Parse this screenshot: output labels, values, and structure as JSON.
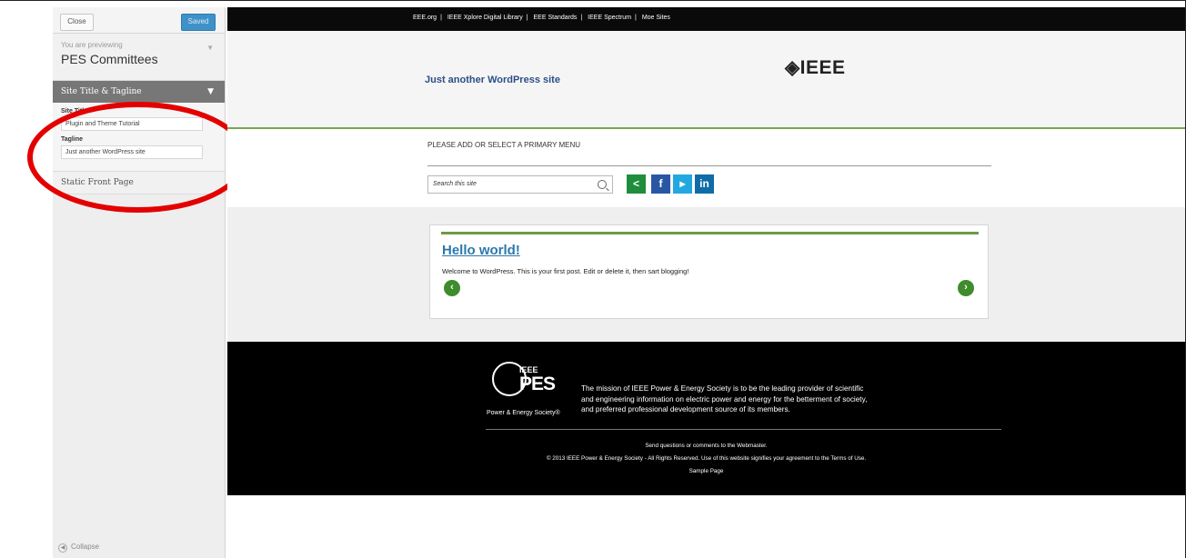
{
  "customizer": {
    "close_label": "Close",
    "saved_label": "Saved",
    "preview_note": "You are previewing",
    "preview_title": "PES Committees",
    "section_title": "Site Title & Tagline",
    "site_title_label": "Site Title",
    "site_title_value": "Plugin and Theme Tutorial",
    "tagline_label": "Tagline",
    "tagline_value": "Just another WordPress site",
    "static_front_page": "Static Front Page",
    "collapse_label": "Collapse"
  },
  "topbar": {
    "links": [
      "EEE.org",
      "IEEE Xplore Digital Library",
      "EEE Standards",
      "IEEE Spectrum",
      "Moe Sites"
    ]
  },
  "site": {
    "tagline": "Just another WordPress site",
    "logo": "IEEE",
    "menu_note": "PLEASE ADD OR SELECT A PRIMARY MENU",
    "search_placeholder": "Search this site"
  },
  "post": {
    "title": "Hello world!",
    "excerpt": "Welcome to WordPress. This is your first post. Edit or delete it, then sart blogging!"
  },
  "footer": {
    "pes_ieee": "IEEE",
    "pes_mark": "PES",
    "pes_society": "Power & Energy Society®",
    "mission_1": "The mission of IEEE Power & Energy Society is to be the leading provider of scientific",
    "mission_2": "and engineering information on electric power and energy for the betterment of society,",
    "mission_3": "and preferred professional development source of its members.",
    "webmaster": "Send questions or comments to the Webmaster.",
    "copyright": "© 2013 IEEE Power & Energy Society - All Rights Reserved. Use of this website signifies your agreement to the Terms of Use.",
    "sample_page": "Sample Page"
  },
  "colors": {
    "highlight_circle": "#e30000",
    "accent_green": "#6c9a45",
    "saved_blue": "#3e92c9"
  }
}
